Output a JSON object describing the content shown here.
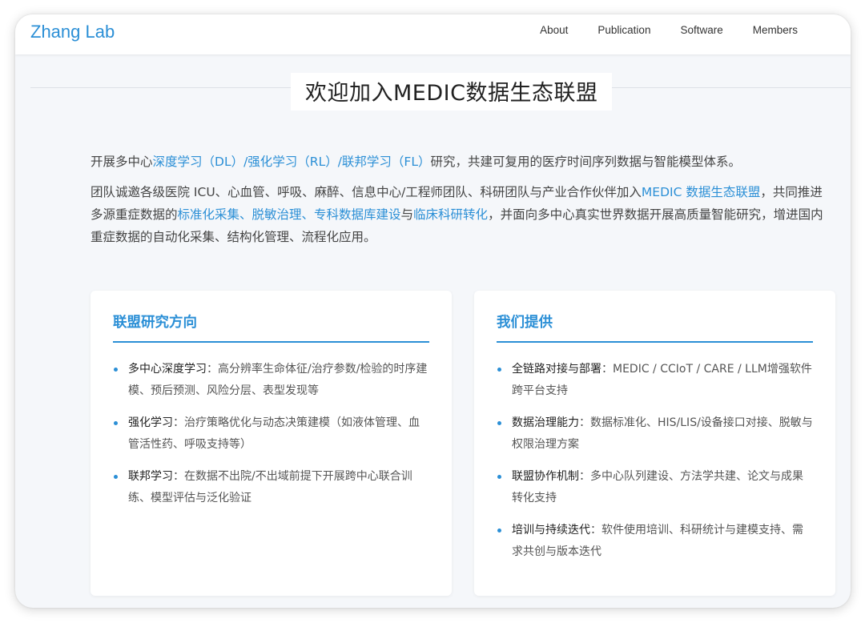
{
  "nav": {
    "brand": "Zhang Lab",
    "links": [
      "About",
      "Publication",
      "Software",
      "Members"
    ]
  },
  "page_title": "欢迎加入MEDIC数据生态联盟",
  "intro": {
    "p1": {
      "pre": "开展多中心",
      "highlight": "深度学习（DL）/强化学习（RL）/联邦学习（FL）",
      "post": "研究，共建可复用的医疗时间序列数据与智能模型体系。"
    },
    "p2": {
      "s1": "团队诚邀各级医院 ICU、心血管、呼吸、麻醉、信息中心/工程师团队、科研团队与产业合作伙伴加入",
      "h1": "MEDIC 数据生态联盟",
      "s2": "，共同推进多源重症数据的",
      "h2": "标准化采集、脱敏治理、专科数据库建设",
      "s3": "与",
      "h3": "临床科研转化",
      "s4": "，并面向多中心真实世界数据开展高质量智能研究，增进国内重症数据的自动化采集、结构化管理、流程化应用。"
    }
  },
  "cards": {
    "left": {
      "title": "联盟研究方向",
      "items": [
        {
          "term": "多中心深度学习",
          "desc": "：高分辨率生命体征/治疗参数/检验的时序建模、预后预测、风险分层、表型发现等"
        },
        {
          "term": "强化学习",
          "desc": "：治疗策略优化与动态决策建模（如液体管理、血管活性药、呼吸支持等）"
        },
        {
          "term": "联邦学习",
          "desc": "：在数据不出院/不出域前提下开展跨中心联合训练、模型评估与泛化验证"
        }
      ]
    },
    "right": {
      "title": "我们提供",
      "items": [
        {
          "term": "全链路对接与部署",
          "desc": "：MEDIC / CCIoT / CARE / LLM增强软件跨平台支持"
        },
        {
          "term": "数据治理能力",
          "desc": "：数据标准化、HIS/LIS/设备接口对接、脱敏与权限治理方案"
        },
        {
          "term": "联盟协作机制",
          "desc": "：多中心队列建设、方法学共建、论文与成果转化支持"
        },
        {
          "term": "培训与持续迭代",
          "desc": "：软件使用培训、科研统计与建模支持、需求共创与版本迭代"
        }
      ]
    }
  },
  "colors": {
    "accent": "#2b8fd6",
    "background": "#f5f7fa"
  }
}
